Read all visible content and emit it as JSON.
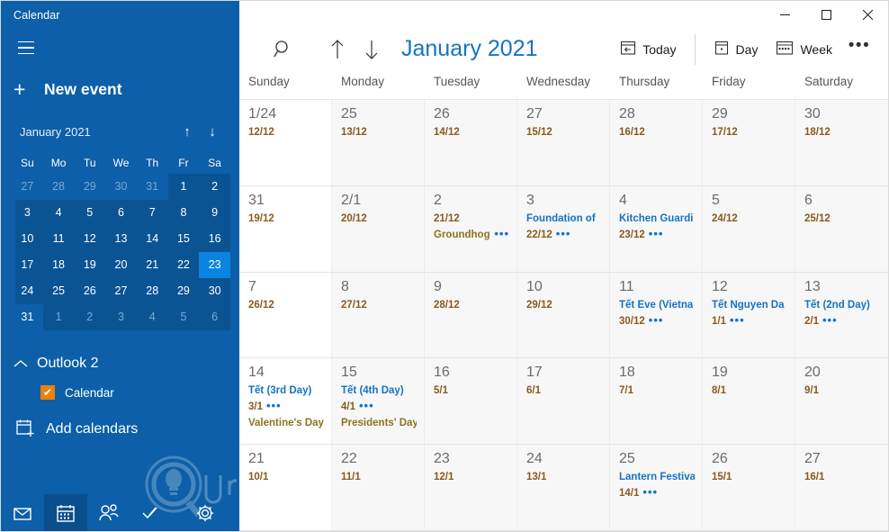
{
  "app": {
    "title": "Calendar"
  },
  "colors": {
    "sidebar_bg": "#0c5fa8",
    "sidebar_shade": "#0a5494",
    "accent_blue": "#1673c4",
    "lunar_brown": "#8a5a1e",
    "olive": "#8a7520",
    "checkbox_orange": "#e8820c",
    "today_highlight": "#0a84e0"
  },
  "sidebar": {
    "hamburger_icon": "hamburger-icon",
    "new_event": {
      "icon": "plus-icon",
      "label": "New event"
    },
    "mini_calendar": {
      "month_label": "January 2021",
      "prev_icon": "arrow-up-icon",
      "next_icon": "arrow-down-icon",
      "dow": [
        "Su",
        "Mo",
        "Tu",
        "We",
        "Th",
        "Fr",
        "Sa"
      ],
      "weeks": [
        [
          {
            "d": "27",
            "muted": true
          },
          {
            "d": "28",
            "muted": true
          },
          {
            "d": "29",
            "muted": true
          },
          {
            "d": "30",
            "muted": true
          },
          {
            "d": "31",
            "muted": true
          },
          {
            "d": "1"
          },
          {
            "d": "2"
          }
        ],
        [
          {
            "d": "3"
          },
          {
            "d": "4"
          },
          {
            "d": "5"
          },
          {
            "d": "6"
          },
          {
            "d": "7"
          },
          {
            "d": "8"
          },
          {
            "d": "9"
          }
        ],
        [
          {
            "d": "10"
          },
          {
            "d": "11"
          },
          {
            "d": "12"
          },
          {
            "d": "13"
          },
          {
            "d": "14"
          },
          {
            "d": "15"
          },
          {
            "d": "16"
          }
        ],
        [
          {
            "d": "17"
          },
          {
            "d": "18"
          },
          {
            "d": "19"
          },
          {
            "d": "20"
          },
          {
            "d": "21"
          },
          {
            "d": "22"
          },
          {
            "d": "23",
            "today": true
          }
        ],
        [
          {
            "d": "24"
          },
          {
            "d": "25"
          },
          {
            "d": "26"
          },
          {
            "d": "27"
          },
          {
            "d": "28"
          },
          {
            "d": "29"
          },
          {
            "d": "30"
          }
        ],
        [
          {
            "d": "31"
          },
          {
            "d": "1",
            "muted": true
          },
          {
            "d": "2",
            "muted": true
          },
          {
            "d": "3",
            "muted": true
          },
          {
            "d": "4",
            "muted": true
          },
          {
            "d": "5",
            "muted": true
          },
          {
            "d": "6",
            "muted": true
          }
        ]
      ]
    },
    "account": {
      "name": "Outlook 2",
      "chevron_icon": "chevron-up-icon"
    },
    "calendar_item": {
      "label": "Calendar",
      "checked": true,
      "check_glyph": "✔"
    },
    "add_calendars": {
      "icon": "add-calendar-icon",
      "label": "Add calendars"
    },
    "bottom_nav": [
      {
        "name": "mail",
        "icon": "mail-icon",
        "active": false
      },
      {
        "name": "calendar",
        "icon": "calendar-icon",
        "active": true
      },
      {
        "name": "people",
        "icon": "people-icon",
        "active": false
      },
      {
        "name": "tasks",
        "icon": "tasks-icon",
        "active": false
      },
      {
        "name": "settings",
        "icon": "gear-icon",
        "active": false
      }
    ],
    "watermark_text": "Quantrimang"
  },
  "window_controls": {
    "minimize": {
      "icon": "minimize-icon",
      "glyph": "─"
    },
    "maximize": {
      "icon": "maximize-icon",
      "glyph": "□"
    },
    "close": {
      "icon": "close-icon",
      "glyph": "✕"
    }
  },
  "toolbar": {
    "search_icon": "search-icon",
    "prev_icon": "arrow-up-icon",
    "next_icon": "arrow-down-icon",
    "month_title": "January 2021",
    "today": {
      "icon": "today-icon",
      "label": "Today"
    },
    "day": {
      "icon": "day-view-icon",
      "label": "Day"
    },
    "week": {
      "icon": "week-view-icon",
      "label": "Week"
    },
    "more": {
      "icon": "ellipsis-icon",
      "glyph": "•••"
    }
  },
  "calendar": {
    "day_headers": [
      "Sunday",
      "Monday",
      "Tuesday",
      "Wednesday",
      "Thursday",
      "Friday",
      "Saturday"
    ],
    "weeks": [
      [
        {
          "day": "1/24",
          "events": [
            {
              "text": "12/12",
              "style": "lunar"
            }
          ]
        },
        {
          "day": "25",
          "events": [
            {
              "text": "13/12",
              "style": "lunar"
            }
          ]
        },
        {
          "day": "26",
          "events": [
            {
              "text": "14/12",
              "style": "lunar"
            }
          ]
        },
        {
          "day": "27",
          "events": [
            {
              "text": "15/12",
              "style": "lunar"
            }
          ]
        },
        {
          "day": "28",
          "events": [
            {
              "text": "16/12",
              "style": "lunar"
            }
          ]
        },
        {
          "day": "29",
          "events": [
            {
              "text": "17/12",
              "style": "lunar"
            }
          ]
        },
        {
          "day": "30",
          "events": [
            {
              "text": "18/12",
              "style": "lunar"
            }
          ]
        }
      ],
      [
        {
          "day": "31",
          "events": [
            {
              "text": "19/12",
              "style": "lunar"
            }
          ]
        },
        {
          "day": "2/1",
          "events": [
            {
              "text": "20/12",
              "style": "lunar"
            }
          ]
        },
        {
          "day": "2",
          "events": [
            {
              "text": "21/12",
              "style": "lunar"
            },
            {
              "text": "Groundhog Da",
              "style": "olive",
              "more": true
            }
          ]
        },
        {
          "day": "3",
          "events": [
            {
              "text": "Foundation of",
              "style": "blue"
            },
            {
              "text": "22/12",
              "style": "lunar",
              "more": true
            }
          ]
        },
        {
          "day": "4",
          "events": [
            {
              "text": "Kitchen Guardi",
              "style": "blue"
            },
            {
              "text": "23/12",
              "style": "lunar",
              "more": true
            }
          ]
        },
        {
          "day": "5",
          "events": [
            {
              "text": "24/12",
              "style": "lunar"
            }
          ]
        },
        {
          "day": "6",
          "events": [
            {
              "text": "25/12",
              "style": "lunar"
            }
          ]
        }
      ],
      [
        {
          "day": "7",
          "events": [
            {
              "text": "26/12",
              "style": "lunar"
            }
          ]
        },
        {
          "day": "8",
          "events": [
            {
              "text": "27/12",
              "style": "lunar"
            }
          ]
        },
        {
          "day": "9",
          "events": [
            {
              "text": "28/12",
              "style": "lunar"
            }
          ]
        },
        {
          "day": "10",
          "events": [
            {
              "text": "29/12",
              "style": "lunar"
            }
          ]
        },
        {
          "day": "11",
          "events": [
            {
              "text": "Tết Eve (Vietna",
              "style": "blue"
            },
            {
              "text": "30/12",
              "style": "lunar",
              "more": true
            }
          ]
        },
        {
          "day": "12",
          "events": [
            {
              "text": "Tết Nguyen Da",
              "style": "blue"
            },
            {
              "text": "1/1",
              "style": "lunar",
              "more": true
            }
          ]
        },
        {
          "day": "13",
          "events": [
            {
              "text": "Tết (2nd Day)",
              "style": "blue"
            },
            {
              "text": "2/1",
              "style": "lunar",
              "more": true
            }
          ]
        }
      ],
      [
        {
          "day": "14",
          "events": [
            {
              "text": "Tết (3rd Day)",
              "style": "blue"
            },
            {
              "text": "3/1",
              "style": "lunar",
              "more": true
            },
            {
              "text": "Valentine's Day",
              "style": "olive"
            }
          ]
        },
        {
          "day": "15",
          "events": [
            {
              "text": "Tết (4th Day)",
              "style": "blue"
            },
            {
              "text": "4/1",
              "style": "lunar",
              "more": true
            },
            {
              "text": "Presidents' Day",
              "style": "olive"
            }
          ]
        },
        {
          "day": "16",
          "events": [
            {
              "text": "5/1",
              "style": "lunar"
            }
          ]
        },
        {
          "day": "17",
          "events": [
            {
              "text": "6/1",
              "style": "lunar"
            }
          ]
        },
        {
          "day": "18",
          "events": [
            {
              "text": "7/1",
              "style": "lunar"
            }
          ]
        },
        {
          "day": "19",
          "events": [
            {
              "text": "8/1",
              "style": "lunar"
            }
          ]
        },
        {
          "day": "20",
          "events": [
            {
              "text": "9/1",
              "style": "lunar"
            }
          ]
        }
      ],
      [
        {
          "day": "21",
          "events": [
            {
              "text": "10/1",
              "style": "lunar"
            }
          ]
        },
        {
          "day": "22",
          "events": [
            {
              "text": "11/1",
              "style": "lunar"
            }
          ]
        },
        {
          "day": "23",
          "events": [
            {
              "text": "12/1",
              "style": "lunar"
            }
          ]
        },
        {
          "day": "24",
          "events": [
            {
              "text": "13/1",
              "style": "lunar"
            }
          ]
        },
        {
          "day": "25",
          "events": [
            {
              "text": "Lantern Festiva",
              "style": "blue"
            },
            {
              "text": "14/1",
              "style": "lunar",
              "more": true
            }
          ]
        },
        {
          "day": "26",
          "events": [
            {
              "text": "15/1",
              "style": "lunar"
            }
          ]
        },
        {
          "day": "27",
          "events": [
            {
              "text": "16/1",
              "style": "lunar"
            }
          ]
        }
      ]
    ]
  }
}
